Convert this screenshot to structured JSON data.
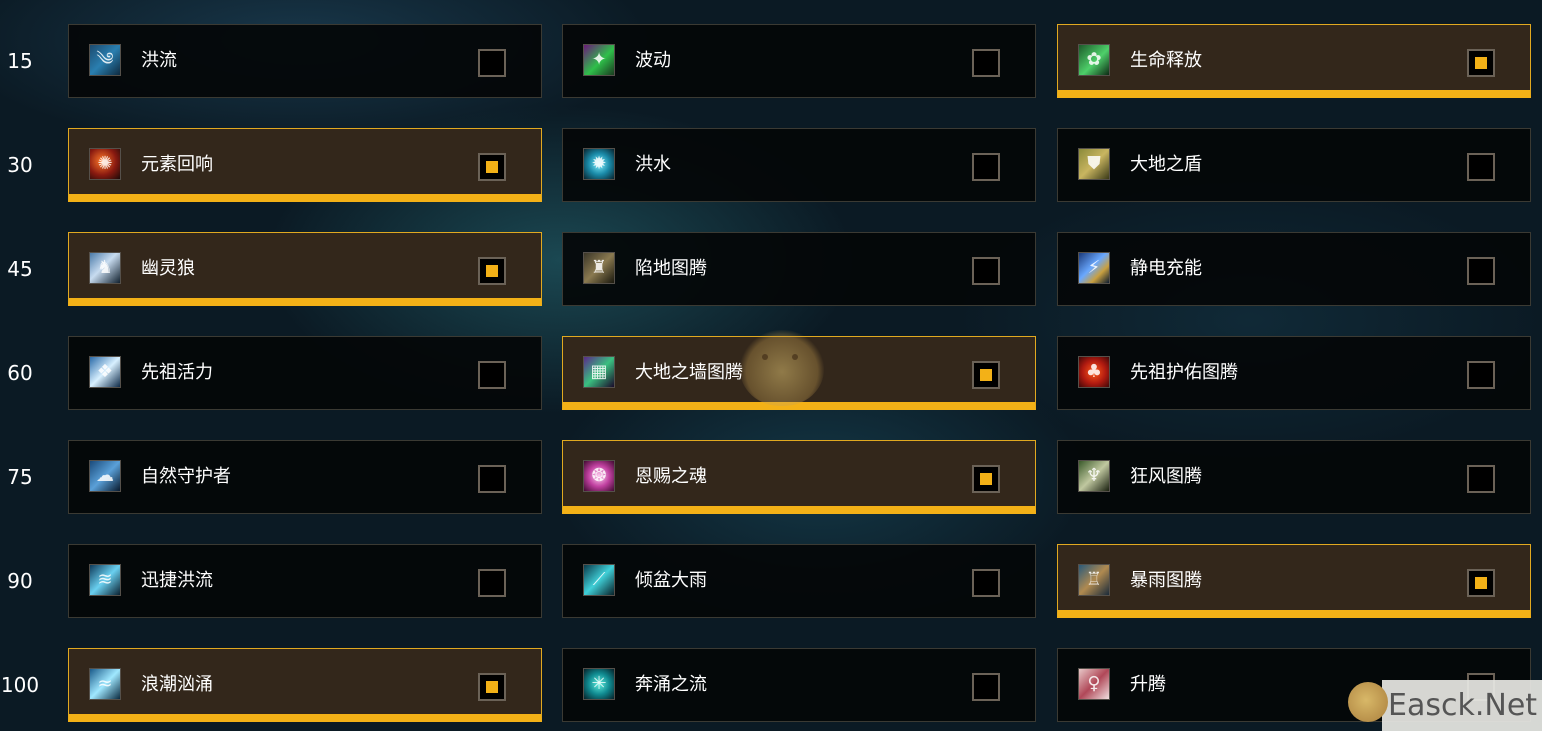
{
  "colors": {
    "accent": "#f3b117",
    "selected_bg": "#33271b",
    "card_bg": "#050709",
    "border": "#3b3a33"
  },
  "rows": [
    {
      "level": "15",
      "talents": [
        {
          "name": "洪流",
          "icon": "torrent-icon",
          "selected": false
        },
        {
          "name": "波动",
          "icon": "undulation-icon",
          "selected": false
        },
        {
          "name": "生命释放",
          "icon": "unleash-life-icon",
          "selected": true
        }
      ]
    },
    {
      "level": "30",
      "talents": [
        {
          "name": "元素回响",
          "icon": "echo-of-the-elements-icon",
          "selected": true
        },
        {
          "name": "洪水",
          "icon": "deluge-icon",
          "selected": false
        },
        {
          "name": "大地之盾",
          "icon": "earth-shield-icon",
          "selected": false
        }
      ]
    },
    {
      "level": "45",
      "talents": [
        {
          "name": "幽灵狼",
          "icon": "spirit-wolf-icon",
          "selected": true
        },
        {
          "name": "陷地图腾",
          "icon": "earthgrab-totem-icon",
          "selected": false
        },
        {
          "name": "静电充能",
          "icon": "static-charge-icon",
          "selected": false
        }
      ]
    },
    {
      "level": "60",
      "talents": [
        {
          "name": "先祖活力",
          "icon": "ancestral-vigor-icon",
          "selected": false
        },
        {
          "name": "大地之墙图腾",
          "icon": "earthen-wall-totem-icon",
          "selected": true
        },
        {
          "name": "先祖护佑图腾",
          "icon": "ancestral-protection-totem-icon",
          "selected": false
        }
      ]
    },
    {
      "level": "75",
      "talents": [
        {
          "name": "自然守护者",
          "icon": "natures-guardian-icon",
          "selected": false
        },
        {
          "name": "恩赐之魂",
          "icon": "graceful-spirit-icon",
          "selected": true
        },
        {
          "name": "狂风图腾",
          "icon": "wind-rush-totem-icon",
          "selected": false
        }
      ]
    },
    {
      "level": "90",
      "talents": [
        {
          "name": "迅捷洪流",
          "icon": "flash-flood-icon",
          "selected": false
        },
        {
          "name": "倾盆大雨",
          "icon": "downpour-icon",
          "selected": false
        },
        {
          "name": "暴雨图腾",
          "icon": "cloudburst-totem-icon",
          "selected": true
        }
      ]
    },
    {
      "level": "100",
      "talents": [
        {
          "name": "浪潮汹涌",
          "icon": "high-tide-icon",
          "selected": true
        },
        {
          "name": "奔涌之流",
          "icon": "wellspring-icon",
          "selected": false
        },
        {
          "name": "升腾",
          "icon": "ascendance-icon",
          "selected": false
        }
      ]
    }
  ],
  "watermark": {
    "text": "Easck.Net"
  }
}
